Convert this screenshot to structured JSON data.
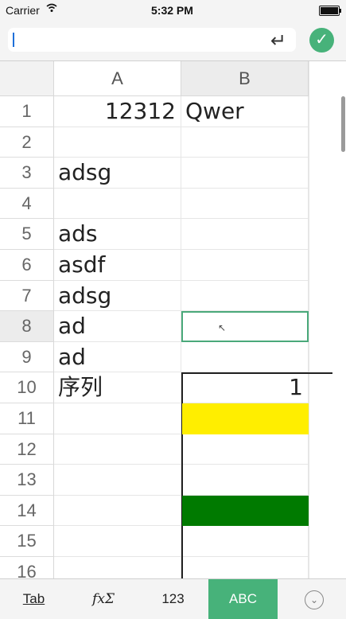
{
  "status_bar": {
    "carrier": "Carrier",
    "wifi_icon": "wifi-icon",
    "time": "5:32 PM",
    "battery_icon": "battery-icon",
    "battery_level": 1.0
  },
  "formula_bar": {
    "value": "",
    "enter_icon": "return-arrow-icon",
    "confirm_icon": "checkmark-icon",
    "confirm_glyph": "✓",
    "enter_glyph": "↵"
  },
  "columns": [
    "A",
    "B"
  ],
  "selected_column": "B",
  "rows": [
    "1",
    "2",
    "3",
    "4",
    "5",
    "6",
    "7",
    "8",
    "9",
    "10",
    "11",
    "12",
    "13",
    "14",
    "15",
    "16"
  ],
  "selected_row": "8",
  "cells": {
    "A1": "12312",
    "B1": "Qwer",
    "A3": "adsg",
    "A5": "ads",
    "A6": "asdf",
    "A7": "adsg",
    "A8": "ad",
    "A9": "ad",
    "A10": "序列",
    "B10": "1"
  },
  "selected_cell": "B8",
  "chart": {
    "bar_colors": [
      "#ffee00",
      "#007a00"
    ]
  },
  "keyboard_bar": {
    "tab": "Tab",
    "function": "fxΣ",
    "numeric": "123",
    "alpha": "ABC",
    "collapse_icon": "chevron-down-icon",
    "collapse_glyph": "⌄",
    "accent": "#47b27a"
  }
}
